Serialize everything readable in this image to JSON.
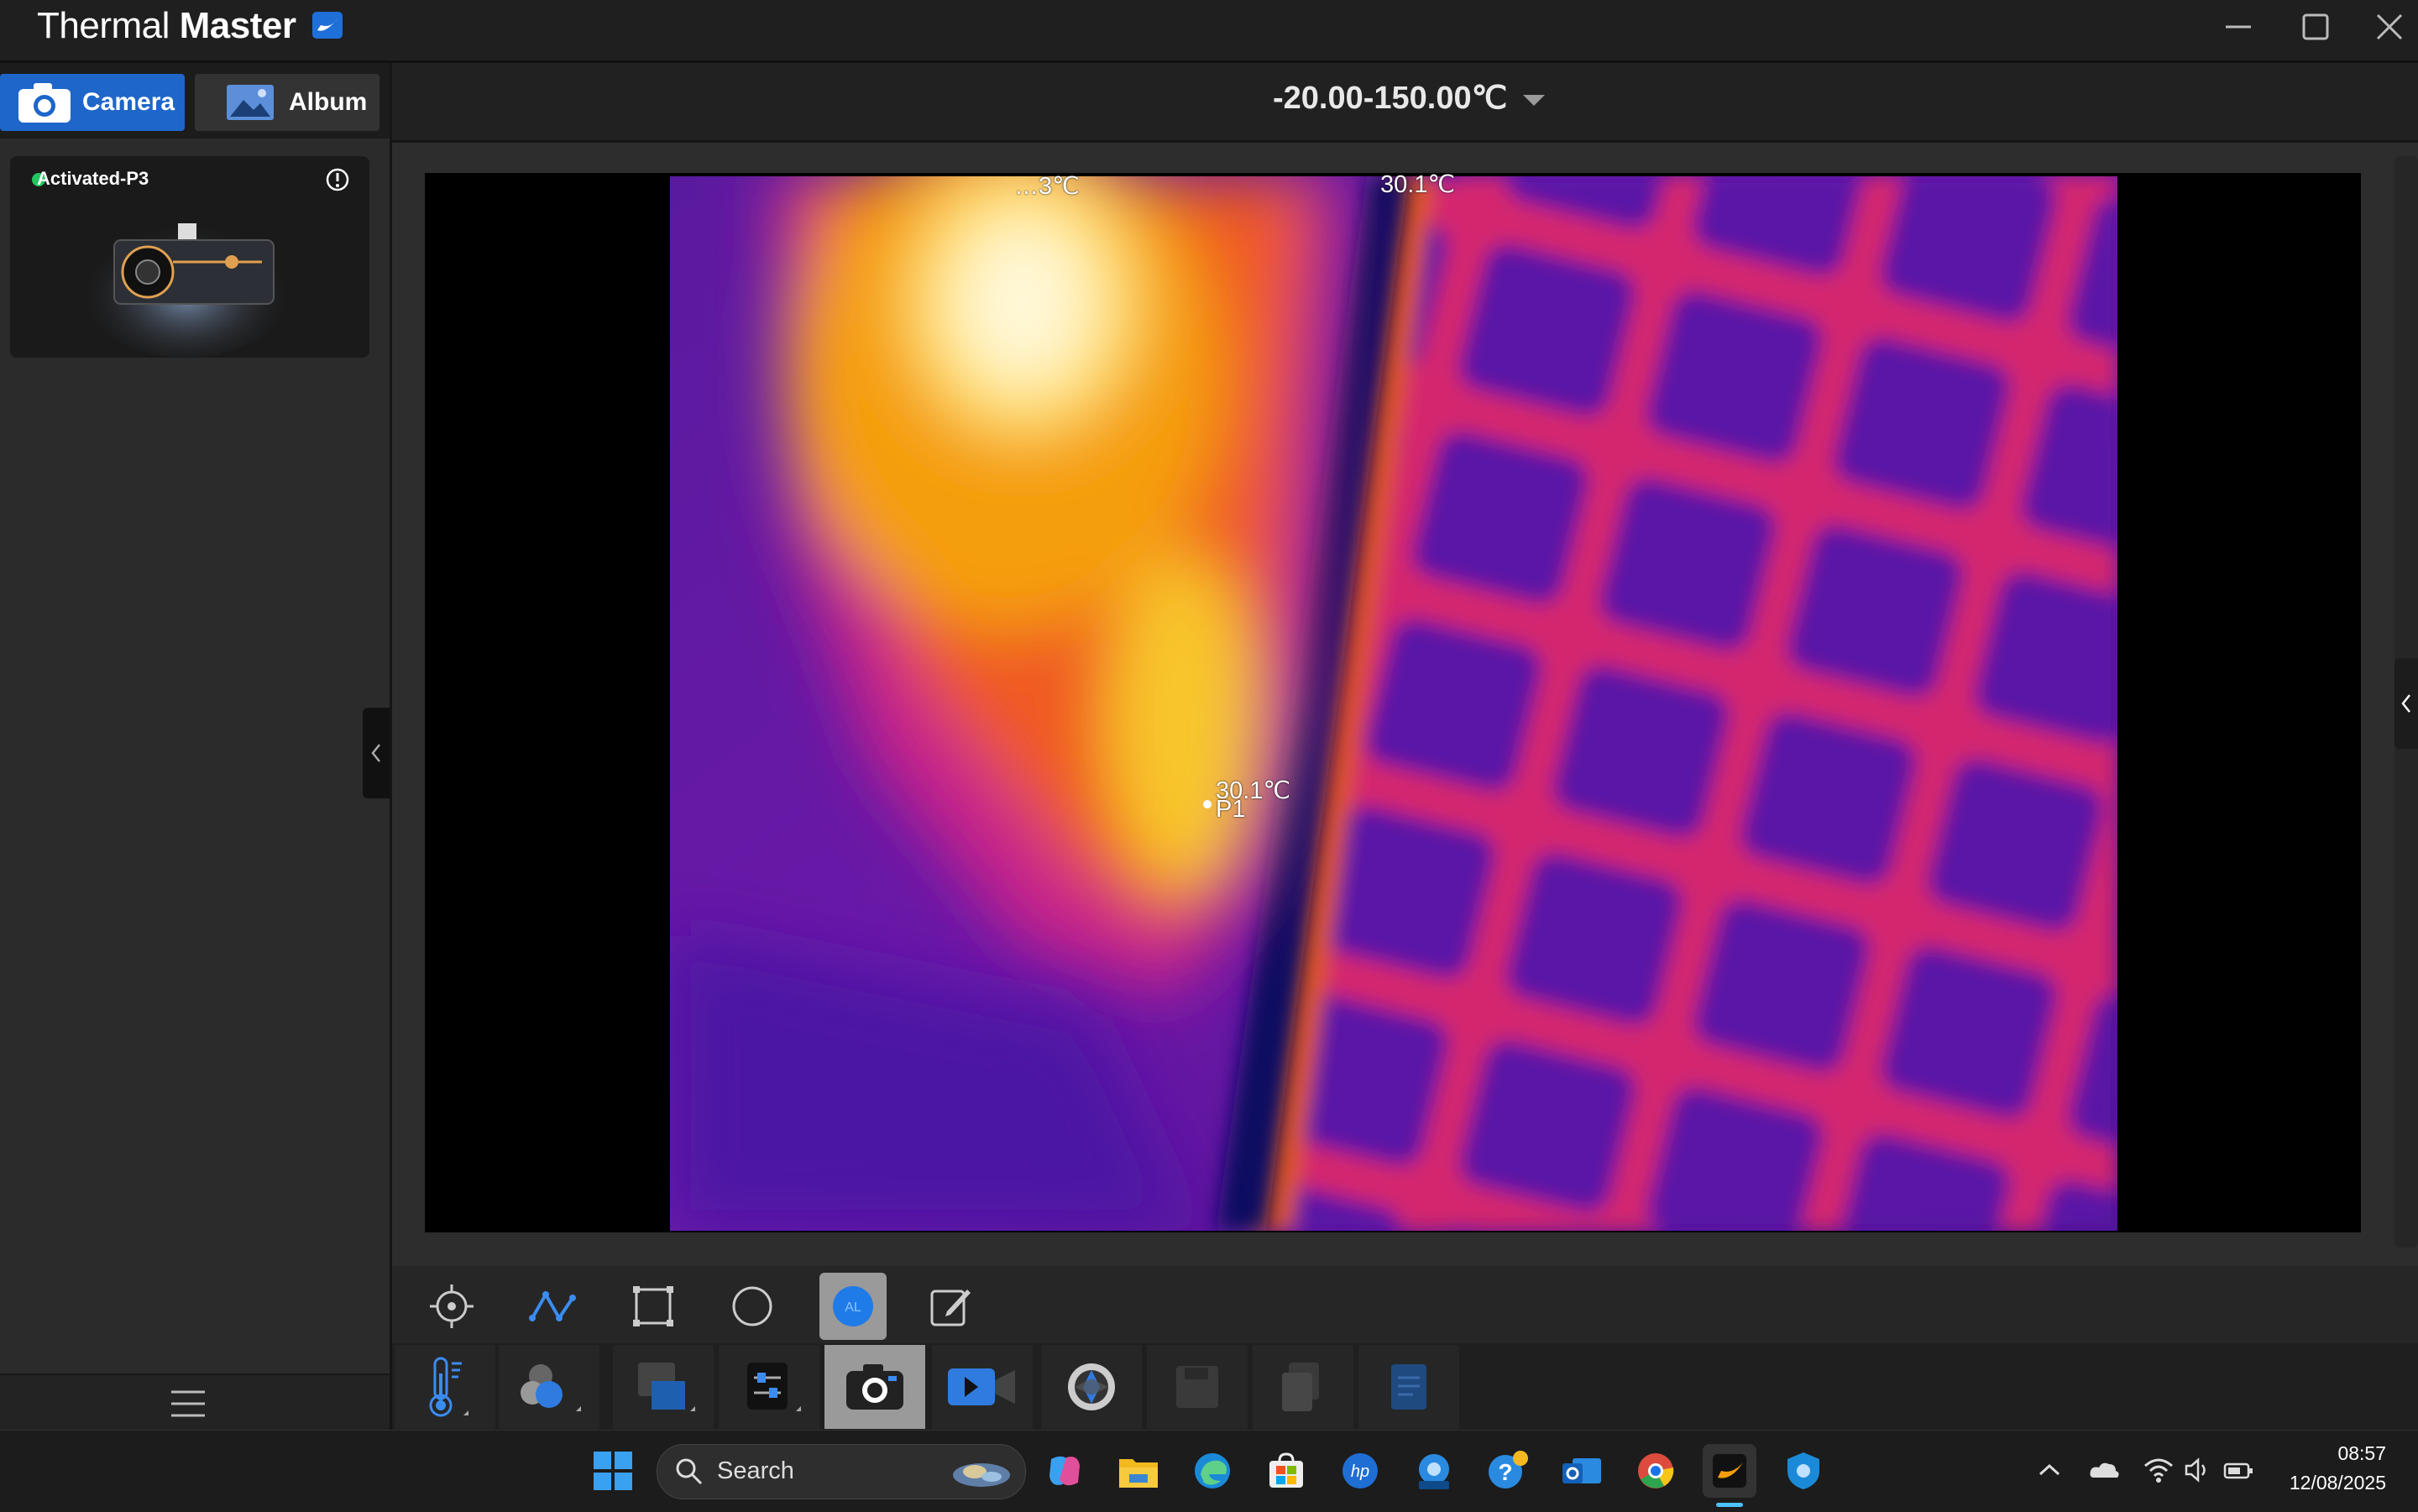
{
  "app": {
    "title_light": "Thermal",
    "title_bold": "Master"
  },
  "tabs": {
    "camera": "Camera",
    "album": "Album"
  },
  "device": {
    "name": "Activated-P3",
    "status_color": "#22c55e"
  },
  "range": {
    "text": "-20.00-150.00℃"
  },
  "image": {
    "labels": {
      "top_left_partial": "…3℃",
      "top_right": "30.1℃",
      "p1_temp": "30.1℃",
      "p1_name": "P1"
    }
  },
  "tools": [
    "target-icon",
    "polyline-icon",
    "rectangle-icon",
    "circle-icon",
    "auto-measure-icon",
    "edit-icon"
  ],
  "toolbar2": [
    "thermometer-icon",
    "palette-icon",
    "overlay-icon",
    "settings-sliders-icon",
    "snapshot-icon",
    "video-record-icon",
    "shutter-icon",
    "save-icon",
    "copy-icon",
    "report-icon"
  ],
  "taskbar": {
    "search_placeholder": "Search",
    "time": "08:57",
    "date": "12/08/2025"
  },
  "colors": {
    "accent": "#1e66c9",
    "background": "#1e1e1e"
  }
}
